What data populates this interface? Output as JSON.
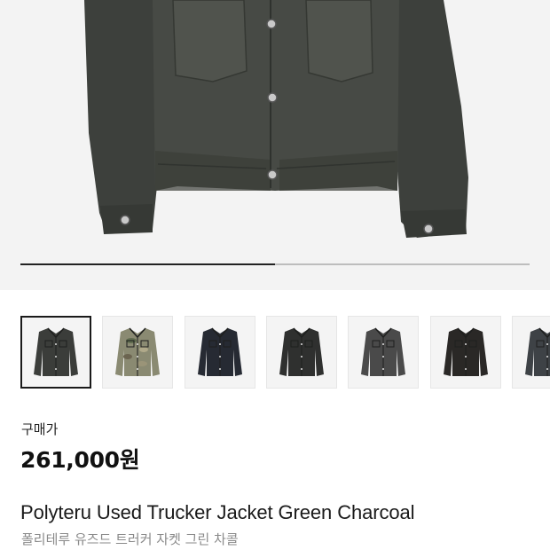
{
  "product_image": {
    "alt_icon": "jacket-photo",
    "progress": 0.5
  },
  "thumbnails": [
    {
      "icon": "jacket-thumbnail",
      "color": "#3b3d3a",
      "selected": true
    },
    {
      "icon": "jacket-thumbnail",
      "color": "#8a8a72",
      "selected": false,
      "camo": true
    },
    {
      "icon": "jacket-thumbnail",
      "color": "#262a33",
      "selected": false
    },
    {
      "icon": "jacket-thumbnail",
      "color": "#2f302f",
      "selected": false
    },
    {
      "icon": "jacket-thumbnail",
      "color": "#4a4a4a",
      "selected": false
    },
    {
      "icon": "jacket-thumbnail",
      "color": "#2a2826",
      "selected": false
    },
    {
      "icon": "jacket-thumbnail",
      "color": "#3e4246",
      "selected": false
    }
  ],
  "price": {
    "label": "구매가",
    "value": "261,000원"
  },
  "product": {
    "name_en": "Polyteru Used Trucker Jacket Green Charcoal",
    "name_ko": "폴리테루 유즈드 트러커 자켓 그린 차콜"
  }
}
